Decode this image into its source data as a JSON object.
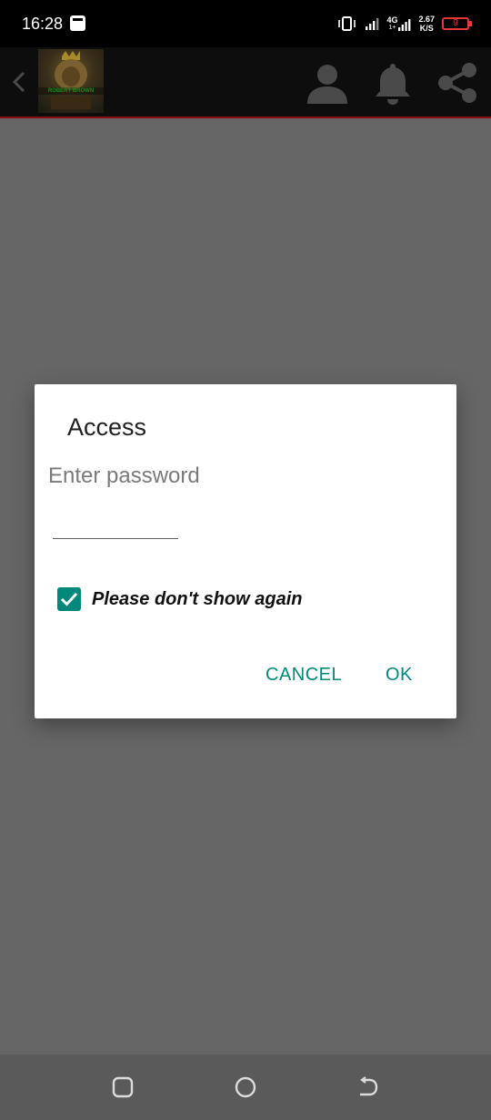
{
  "status_bar": {
    "time": "16:28",
    "network_type": "4G",
    "network_sub": "1+",
    "speed_value": "2.67",
    "speed_unit": "K/S",
    "battery_level": "9",
    "icons": [
      "notification-app-icon",
      "vibrate-icon",
      "signal-icon",
      "signal-4g-icon",
      "battery-icon"
    ]
  },
  "toolbar": {
    "logo_text": "ROBERT BROWN",
    "icons": [
      "back-icon",
      "profile-icon",
      "bell-icon",
      "share-icon"
    ]
  },
  "dialog": {
    "title": "Access",
    "message": "Enter password",
    "password_value": "",
    "checkbox_label": "Please don't show again",
    "checkbox_checked": true,
    "cancel_label": "CANCEL",
    "ok_label": "OK"
  },
  "nav_bar": {
    "icons": [
      "recents-icon",
      "home-icon",
      "back-nav-icon"
    ]
  },
  "colors": {
    "accent": "#00897b",
    "scrim": "#666666",
    "toolbar_accent": "#8b0f0f",
    "battery_low": "#e53935"
  }
}
